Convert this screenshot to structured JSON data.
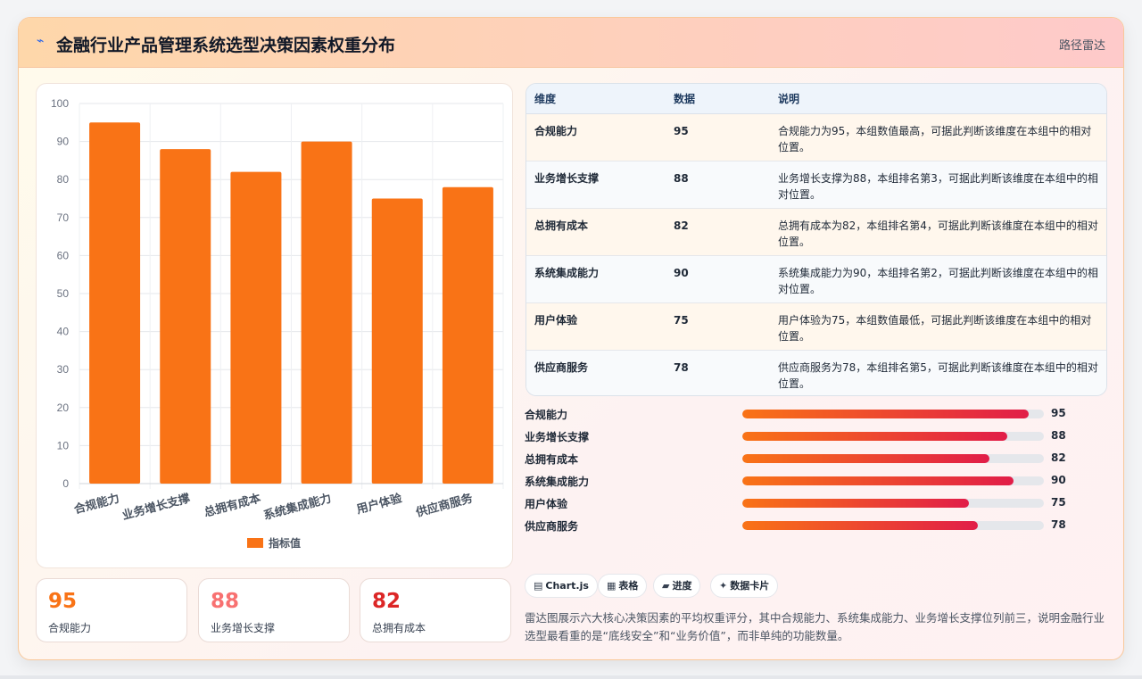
{
  "header": {
    "icon": "line-chart-icon",
    "title": "金融行业产品管理系统选型决策因素权重分布",
    "subtitle": "路径雷达"
  },
  "colors": {
    "bar": "#f97316",
    "accent_orange": "#f97316",
    "accent_rose": "#f87171",
    "accent_red": "#dc2626",
    "gradient_start": "#f97316",
    "gradient_end": "#e11d48"
  },
  "chart_data": {
    "type": "bar",
    "categories": [
      "合规能力",
      "业务增长支撑",
      "总拥有成本",
      "系统集成能力",
      "用户体验",
      "供应商服务"
    ],
    "series": [
      {
        "name": "指标值",
        "values": [
          95,
          88,
          82,
          90,
          75,
          78
        ]
      }
    ],
    "ylim": [
      0,
      100
    ],
    "yticks": [
      0,
      10,
      20,
      30,
      40,
      50,
      60,
      70,
      80,
      90,
      100
    ],
    "grid": true,
    "legend": "bottom"
  },
  "kpis": [
    {
      "value": "95",
      "label": "合规能力"
    },
    {
      "value": "88",
      "label": "业务增长支撑"
    },
    {
      "value": "82",
      "label": "总拥有成本"
    }
  ],
  "table": {
    "headers": [
      "维度",
      "数据",
      "说明"
    ],
    "rows": [
      {
        "name": "合规能力",
        "value": "95",
        "note": "合规能力为95，本组数值最高，可据此判断该维度在本组中的相对位置。"
      },
      {
        "name": "业务增长支撑",
        "value": "88",
        "note": "业务增长支撑为88，本组排名第3，可据此判断该维度在本组中的相对位置。"
      },
      {
        "name": "总拥有成本",
        "value": "82",
        "note": "总拥有成本为82，本组排名第4，可据此判断该维度在本组中的相对位置。"
      },
      {
        "name": "系统集成能力",
        "value": "90",
        "note": "系统集成能力为90，本组排名第2，可据此判断该维度在本组中的相对位置。"
      },
      {
        "name": "用户体验",
        "value": "75",
        "note": "用户体验为75，本组数值最低，可据此判断该维度在本组中的相对位置。"
      },
      {
        "name": "供应商服务",
        "value": "78",
        "note": "供应商服务为78，本组排名第5，可据此判断该维度在本组中的相对位置。"
      }
    ]
  },
  "progress": {
    "max": 100,
    "items": [
      {
        "label": "合规能力",
        "value": 95
      },
      {
        "label": "业务增长支撑",
        "value": 88
      },
      {
        "label": "总拥有成本",
        "value": 82
      },
      {
        "label": "系统集成能力",
        "value": 90
      },
      {
        "label": "用户体验",
        "value": 75
      },
      {
        "label": "供应商服务",
        "value": 78
      }
    ]
  },
  "tags": [
    {
      "icon": "chart-icon",
      "glyph": "▤",
      "label": "Chart.js"
    },
    {
      "icon": "table-icon",
      "glyph": "▦",
      "label": "表格"
    },
    {
      "icon": "progress-icon",
      "glyph": "▰",
      "label": "进度"
    },
    {
      "icon": "card-icon",
      "glyph": "✦",
      "label": "数据卡片"
    }
  ],
  "description": "雷达图展示六大核心决策因素的平均权重评分，其中合规能力、系统集成能力、业务增长支撑位列前三，说明金融行业选型最看重的是“底线安全”和“业务价值”，而非单纯的功能数量。"
}
